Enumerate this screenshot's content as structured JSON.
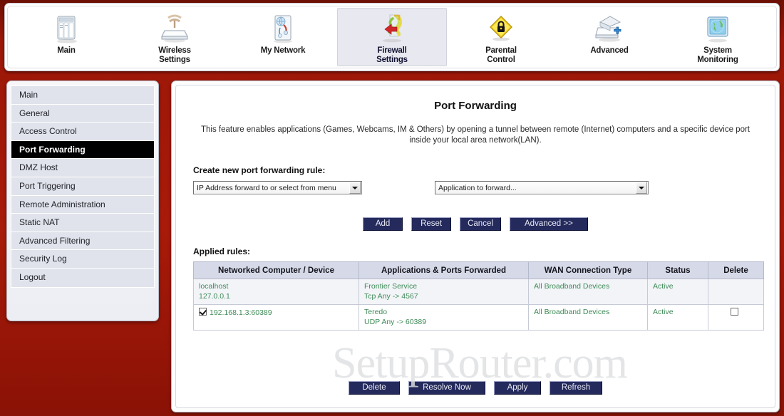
{
  "topnav": {
    "items": [
      {
        "label": "Main",
        "icon": "window-panels-icon",
        "selected": false
      },
      {
        "label": "Wireless\nSettings",
        "icon": "wireless-antenna-icon",
        "selected": false
      },
      {
        "label": "My Network",
        "icon": "network-globe-icon",
        "selected": false
      },
      {
        "label": "Firewall\nSettings",
        "icon": "firewall-arrows-icon",
        "selected": true
      },
      {
        "label": "Parental\nControl",
        "icon": "yellow-lock-diamond-icon",
        "selected": false
      },
      {
        "label": "Advanced",
        "icon": "box-gear-plus-icon",
        "selected": false
      },
      {
        "label": "System\nMonitoring",
        "icon": "monitor-globe-icon",
        "selected": false
      }
    ]
  },
  "sidebar": {
    "items": [
      {
        "label": "Main",
        "active": false
      },
      {
        "label": "General",
        "active": false
      },
      {
        "label": "Access Control",
        "active": false
      },
      {
        "label": "Port Forwarding",
        "active": true
      },
      {
        "label": "DMZ Host",
        "active": false
      },
      {
        "label": "Port Triggering",
        "active": false
      },
      {
        "label": "Remote Administration",
        "active": false
      },
      {
        "label": "Static NAT",
        "active": false
      },
      {
        "label": "Advanced Filtering",
        "active": false
      },
      {
        "label": "Security Log",
        "active": false
      },
      {
        "label": "Logout",
        "active": false
      }
    ]
  },
  "main": {
    "title": "Port Forwarding",
    "description": "This feature enables applications (Games, Webcams, IM & Others) by opening a tunnel between remote (Internet) computers and a specific device port inside your local area network(LAN).",
    "create_rule_label": "Create new port forwarding rule:",
    "select_ip_value": "IP Address forward to or select from menu",
    "select_app_value": "Application to forward...",
    "buttons_top": [
      {
        "id": "add",
        "label": "Add"
      },
      {
        "id": "reset",
        "label": "Reset"
      },
      {
        "id": "cancel",
        "label": "Cancel"
      },
      {
        "id": "advanced",
        "label": "Advanced >>"
      }
    ],
    "applied_rules_label": "Applied rules:",
    "table": {
      "columns": [
        "Networked Computer / Device",
        "Applications & Ports Forwarded",
        "WAN Connection Type",
        "Status",
        "Delete"
      ],
      "rows": [
        {
          "device_name": "localhost",
          "device_detail": "127.0.0.1",
          "device_checkbox": null,
          "application": "Frontier Service",
          "ports": "Tcp Any -> 4567",
          "wan_type": "All Broadband Devices",
          "status": "Active",
          "delete_checkbox": null
        },
        {
          "device_name": "192.168.1.3:60389",
          "device_detail": "",
          "device_checkbox": "checked",
          "application": "Teredo",
          "ports": "UDP Any -> 60389",
          "wan_type": "All Broadband Devices",
          "status": "Active",
          "delete_checkbox": "unchecked"
        }
      ]
    },
    "buttons_bottom": [
      {
        "id": "delete",
        "label": "Delete"
      },
      {
        "id": "resolve",
        "label": "Resolve Now"
      },
      {
        "id": "apply",
        "label": "Apply"
      },
      {
        "id": "refresh",
        "label": "Refresh"
      }
    ],
    "watermark": "SetupRouter.com"
  },
  "colors": {
    "page_background": "#a81a09",
    "active_nav": "#000000",
    "button": "#242a5c",
    "table_header": "#d6dae8",
    "table_text": "#3f8b57",
    "selected_tab": "#e8e8f0"
  }
}
